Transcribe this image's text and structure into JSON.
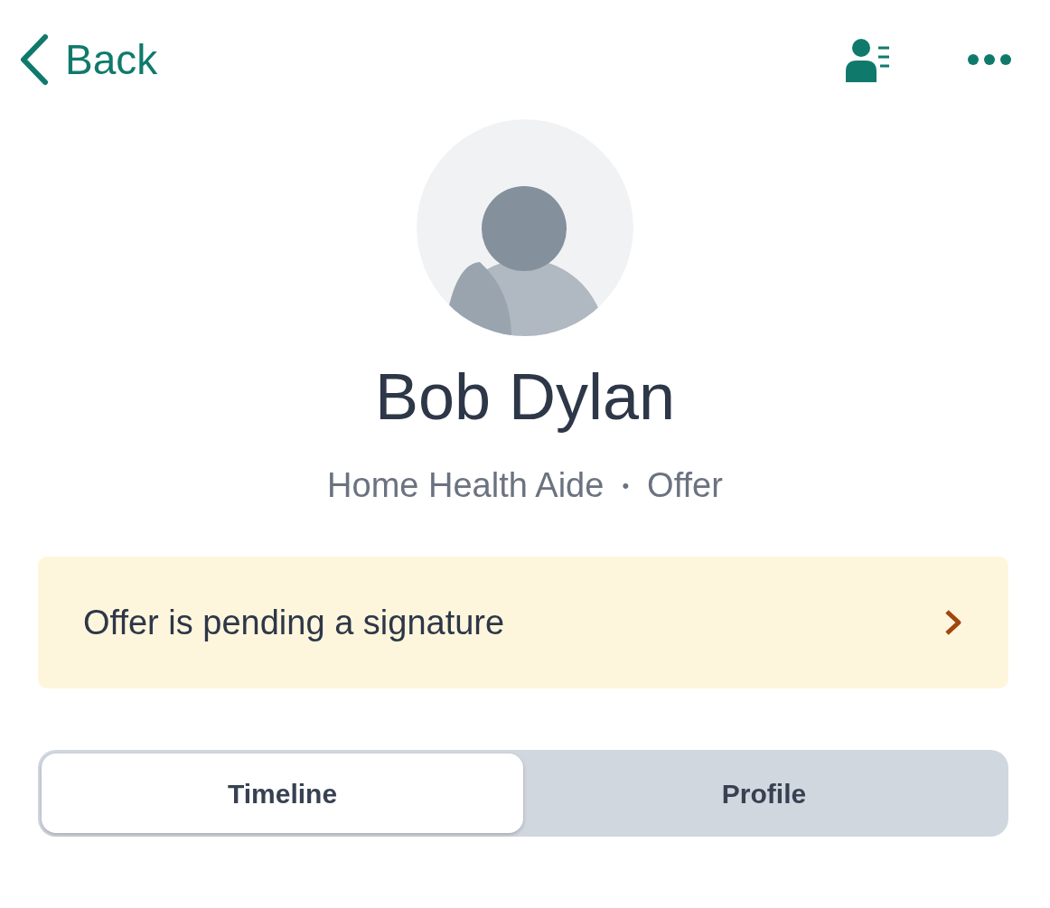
{
  "header": {
    "back_label": "Back"
  },
  "profile": {
    "name": "Bob Dylan",
    "role": "Home Health Aide",
    "separator": "•",
    "status": "Offer"
  },
  "alert": {
    "text": "Offer is pending a signature"
  },
  "tabs": [
    {
      "label": "Timeline",
      "selected": true
    },
    {
      "label": "Profile",
      "selected": false
    }
  ]
}
